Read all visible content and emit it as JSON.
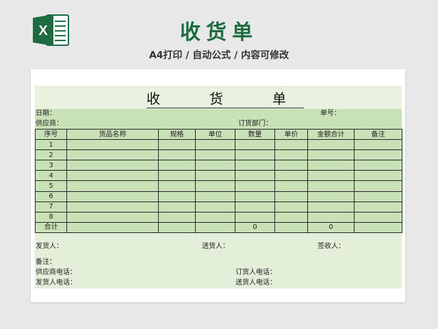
{
  "header": {
    "title": "收货单",
    "subtitle": "A4打印 / 自动公式 / 内容可修改",
    "logo_letter": "X",
    "logo_color": "#1d6b41"
  },
  "form": {
    "title": "收　货　单",
    "date_label": "日期：",
    "order_no_label": "单号：",
    "supplier_label": "供应商：",
    "order_dept_label": "订货部门：",
    "columns": [
      "序号",
      "货品名称",
      "规格",
      "单位",
      "数量",
      "单价",
      "金额合计",
      "备注"
    ],
    "rows": [
      [
        "1",
        "",
        "",
        "",
        "",
        "",
        "",
        ""
      ],
      [
        "2",
        "",
        "",
        "",
        "",
        "",
        "",
        ""
      ],
      [
        "3",
        "",
        "",
        "",
        "",
        "",
        "",
        ""
      ],
      [
        "4",
        "",
        "",
        "",
        "",
        "",
        "",
        ""
      ],
      [
        "5",
        "",
        "",
        "",
        "",
        "",
        "",
        ""
      ],
      [
        "6",
        "",
        "",
        "",
        "",
        "",
        "",
        ""
      ],
      [
        "7",
        "",
        "",
        "",
        "",
        "",
        "",
        ""
      ],
      [
        "8",
        "",
        "",
        "",
        "",
        "",
        "",
        ""
      ]
    ],
    "total_row": [
      "合计",
      "",
      "",
      "",
      "0",
      "",
      "0",
      ""
    ],
    "shipper_label": "发货人：",
    "deliverer_label": "送货人：",
    "receiver_label": "签收人：",
    "remark_label": "备注：",
    "supplier_phone_label": "供应商电话：",
    "orderer_phone_label": "订货人电话：",
    "shipper_phone_label": "发货人电话：",
    "deliverer_phone_label": "送货人电话："
  },
  "colors": {
    "accent": "#1d6b41",
    "band": "#c9e1b6",
    "sheet_bg": "#e3efd9"
  }
}
